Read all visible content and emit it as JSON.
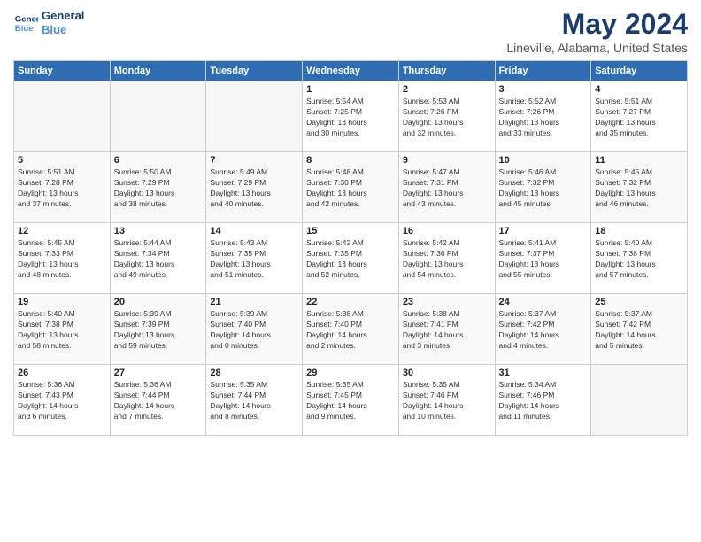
{
  "logo": {
    "line1": "General",
    "line2": "Blue"
  },
  "title": "May 2024",
  "subtitle": "Lineville, Alabama, United States",
  "days_of_week": [
    "Sunday",
    "Monday",
    "Tuesday",
    "Wednesday",
    "Thursday",
    "Friday",
    "Saturday"
  ],
  "weeks": [
    [
      {
        "day": "",
        "detail": ""
      },
      {
        "day": "",
        "detail": ""
      },
      {
        "day": "",
        "detail": ""
      },
      {
        "day": "1",
        "detail": "Sunrise: 5:54 AM\nSunset: 7:25 PM\nDaylight: 13 hours\nand 30 minutes."
      },
      {
        "day": "2",
        "detail": "Sunrise: 5:53 AM\nSunset: 7:26 PM\nDaylight: 13 hours\nand 32 minutes."
      },
      {
        "day": "3",
        "detail": "Sunrise: 5:52 AM\nSunset: 7:26 PM\nDaylight: 13 hours\nand 33 minutes."
      },
      {
        "day": "4",
        "detail": "Sunrise: 5:51 AM\nSunset: 7:27 PM\nDaylight: 13 hours\nand 35 minutes."
      }
    ],
    [
      {
        "day": "5",
        "detail": "Sunrise: 5:51 AM\nSunset: 7:28 PM\nDaylight: 13 hours\nand 37 minutes."
      },
      {
        "day": "6",
        "detail": "Sunrise: 5:50 AM\nSunset: 7:29 PM\nDaylight: 13 hours\nand 38 minutes."
      },
      {
        "day": "7",
        "detail": "Sunrise: 5:49 AM\nSunset: 7:29 PM\nDaylight: 13 hours\nand 40 minutes."
      },
      {
        "day": "8",
        "detail": "Sunrise: 5:48 AM\nSunset: 7:30 PM\nDaylight: 13 hours\nand 42 minutes."
      },
      {
        "day": "9",
        "detail": "Sunrise: 5:47 AM\nSunset: 7:31 PM\nDaylight: 13 hours\nand 43 minutes."
      },
      {
        "day": "10",
        "detail": "Sunrise: 5:46 AM\nSunset: 7:32 PM\nDaylight: 13 hours\nand 45 minutes."
      },
      {
        "day": "11",
        "detail": "Sunrise: 5:45 AM\nSunset: 7:32 PM\nDaylight: 13 hours\nand 46 minutes."
      }
    ],
    [
      {
        "day": "12",
        "detail": "Sunrise: 5:45 AM\nSunset: 7:33 PM\nDaylight: 13 hours\nand 48 minutes."
      },
      {
        "day": "13",
        "detail": "Sunrise: 5:44 AM\nSunset: 7:34 PM\nDaylight: 13 hours\nand 49 minutes."
      },
      {
        "day": "14",
        "detail": "Sunrise: 5:43 AM\nSunset: 7:35 PM\nDaylight: 13 hours\nand 51 minutes."
      },
      {
        "day": "15",
        "detail": "Sunrise: 5:42 AM\nSunset: 7:35 PM\nDaylight: 13 hours\nand 52 minutes."
      },
      {
        "day": "16",
        "detail": "Sunrise: 5:42 AM\nSunset: 7:36 PM\nDaylight: 13 hours\nand 54 minutes."
      },
      {
        "day": "17",
        "detail": "Sunrise: 5:41 AM\nSunset: 7:37 PM\nDaylight: 13 hours\nand 55 minutes."
      },
      {
        "day": "18",
        "detail": "Sunrise: 5:40 AM\nSunset: 7:38 PM\nDaylight: 13 hours\nand 57 minutes."
      }
    ],
    [
      {
        "day": "19",
        "detail": "Sunrise: 5:40 AM\nSunset: 7:38 PM\nDaylight: 13 hours\nand 58 minutes."
      },
      {
        "day": "20",
        "detail": "Sunrise: 5:39 AM\nSunset: 7:39 PM\nDaylight: 13 hours\nand 59 minutes."
      },
      {
        "day": "21",
        "detail": "Sunrise: 5:39 AM\nSunset: 7:40 PM\nDaylight: 14 hours\nand 0 minutes."
      },
      {
        "day": "22",
        "detail": "Sunrise: 5:38 AM\nSunset: 7:40 PM\nDaylight: 14 hours\nand 2 minutes."
      },
      {
        "day": "23",
        "detail": "Sunrise: 5:38 AM\nSunset: 7:41 PM\nDaylight: 14 hours\nand 3 minutes."
      },
      {
        "day": "24",
        "detail": "Sunrise: 5:37 AM\nSunset: 7:42 PM\nDaylight: 14 hours\nand 4 minutes."
      },
      {
        "day": "25",
        "detail": "Sunrise: 5:37 AM\nSunset: 7:42 PM\nDaylight: 14 hours\nand 5 minutes."
      }
    ],
    [
      {
        "day": "26",
        "detail": "Sunrise: 5:36 AM\nSunset: 7:43 PM\nDaylight: 14 hours\nand 6 minutes."
      },
      {
        "day": "27",
        "detail": "Sunrise: 5:36 AM\nSunset: 7:44 PM\nDaylight: 14 hours\nand 7 minutes."
      },
      {
        "day": "28",
        "detail": "Sunrise: 5:35 AM\nSunset: 7:44 PM\nDaylight: 14 hours\nand 8 minutes."
      },
      {
        "day": "29",
        "detail": "Sunrise: 5:35 AM\nSunset: 7:45 PM\nDaylight: 14 hours\nand 9 minutes."
      },
      {
        "day": "30",
        "detail": "Sunrise: 5:35 AM\nSunset: 7:46 PM\nDaylight: 14 hours\nand 10 minutes."
      },
      {
        "day": "31",
        "detail": "Sunrise: 5:34 AM\nSunset: 7:46 PM\nDaylight: 14 hours\nand 11 minutes."
      },
      {
        "day": "",
        "detail": ""
      }
    ]
  ]
}
